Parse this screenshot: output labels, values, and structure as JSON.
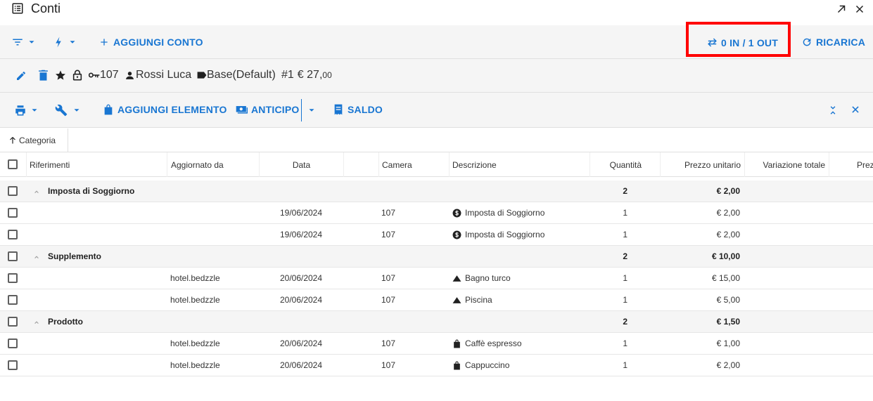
{
  "window": {
    "title": "Conti",
    "icons": {
      "app": "list-alt-icon",
      "expand": "open-in-new-icon",
      "close": "close-icon"
    }
  },
  "toolbar": {
    "filter_icon": "filter-icon",
    "actions_icon": "bolt-icon",
    "add_account_label": "AGGIUNGI CONTO",
    "transfer_label": "0 IN / 1 OUT",
    "reload_label": "RICARICA"
  },
  "account": {
    "room": "107",
    "guest": "Rossi Luca",
    "rate": "Base(Default)",
    "number": "#1",
    "amount_main": "€ 27,",
    "amount_cents": "00"
  },
  "toolbar2": {
    "add_item_label": "AGGIUNGI ELEMENTO",
    "advance_label": "ANTICIPO",
    "balance_label": "SALDO"
  },
  "grouping": {
    "label": "Categoria"
  },
  "table": {
    "columns": [
      "Riferimenti",
      "Aggiornato da",
      "Data",
      "",
      "Camera",
      "Descrizione",
      "Quantità",
      "Prezzo unitario",
      "Variazione totale",
      "Prezzo"
    ],
    "groups": [
      {
        "name": "Imposta di Soggiorno",
        "quantity": "2",
        "unit_price": "€ 2,00",
        "rows": [
          {
            "updated_by": "",
            "date": "19/06/2024",
            "room": "107",
            "icon": "dollar-circle-icon",
            "description": "Imposta di Soggiorno",
            "quantity": "1",
            "unit_price": "€ 2,00"
          },
          {
            "updated_by": "",
            "date": "19/06/2024",
            "room": "107",
            "icon": "dollar-circle-icon",
            "description": "Imposta di Soggiorno",
            "quantity": "1",
            "unit_price": "€ 2,00"
          }
        ]
      },
      {
        "name": "Supplemento",
        "quantity": "2",
        "unit_price": "€ 10,00",
        "rows": [
          {
            "updated_by": "hotel.bedzzle",
            "date": "20/06/2024",
            "room": "107",
            "icon": "triangle-icon",
            "description": "Bagno turco",
            "quantity": "1",
            "unit_price": "€ 15,00"
          },
          {
            "updated_by": "hotel.bedzzle",
            "date": "20/06/2024",
            "room": "107",
            "icon": "triangle-icon",
            "description": "Piscina",
            "quantity": "1",
            "unit_price": "€ 5,00"
          }
        ]
      },
      {
        "name": "Prodotto",
        "quantity": "2",
        "unit_price": "€ 1,50",
        "rows": [
          {
            "updated_by": "hotel.bedzzle",
            "date": "20/06/2024",
            "room": "107",
            "icon": "shopping-bag-icon",
            "description": "Caffè espresso",
            "quantity": "1",
            "unit_price": "€ 1,00"
          },
          {
            "updated_by": "hotel.bedzzle",
            "date": "20/06/2024",
            "room": "107",
            "icon": "shopping-bag-icon",
            "description": "Cappuccino",
            "quantity": "1",
            "unit_price": "€ 2,00"
          }
        ]
      }
    ]
  },
  "colors": {
    "accent": "#1976d2",
    "highlight": "#ff0000",
    "toolbar_bg": "#f5f5f5"
  }
}
